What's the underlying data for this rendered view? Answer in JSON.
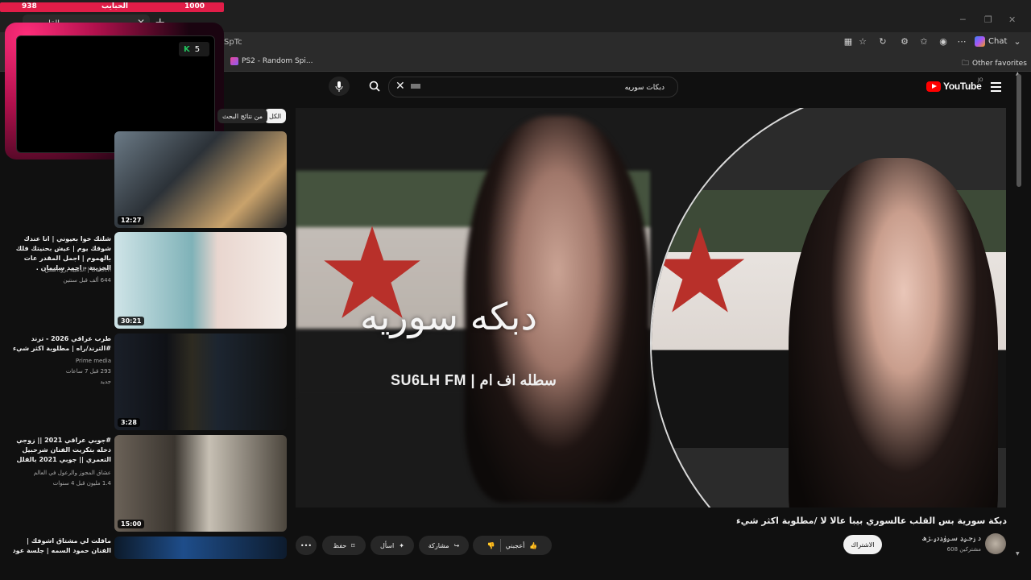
{
  "overlay": {
    "left_value": "938",
    "center_label": "الحبايب",
    "right_value": "1000",
    "score_value": "5"
  },
  "browser": {
    "tab_title": "ج ريه بس القلب",
    "url_fragment": "SpTc",
    "bookmarks": [
      {
        "label": "PS2 - Random Spi..."
      },
      {
        "label": "Other favorites"
      }
    ],
    "chat_label": "Chat"
  },
  "youtube": {
    "logo_text": "YouTube",
    "logo_sup": "JO",
    "search_value": "دبكات سوريه",
    "chips": {
      "active": "الكل",
      "normal": "من نتائج البحث"
    },
    "player": {
      "overlay_title": "دبكه سوريه",
      "overlay_subtitle": "SU6LH FM | سطله اف ام"
    },
    "video": {
      "title": "دبكة سورية بس القلب عالسوري بيبا عالا لا /مطلوبة اكثر شيء",
      "channel": "د ۏجـﯠﮃ ﺳـﯠﯛﮃﺩﯠۦﮋﮪ",
      "subs": "608 مشتركين",
      "subscribe_label": "الاشتراك",
      "actions": {
        "like": "أعجبني",
        "share": "مشاركة",
        "ask": "اسأل",
        "save": "حفظ"
      }
    },
    "recommendations": [
      {
        "duration": "12:27",
        "title": "",
        "channel": "",
        "meta": ""
      },
      {
        "duration": "30:21",
        "title": "شلتك خوا بعيوني | انا عندك شوقك يوم | عيش بحنيتك فلك بالهموم | اجمل المقدر عات الحزينة - احمد سليمان .",
        "channel": "Golden | الذهبية بروداكشن",
        "meta": "644 ألف  قبل سنتين"
      },
      {
        "duration": "3:28",
        "title": "طرب عراقي 2026 - ترند #الترند/راه | مطلوبة اكثر شيء",
        "channel": "Prime media",
        "meta": "293  قبل 7 ساعات",
        "badge": "جديد"
      },
      {
        "duration": "15:00",
        "title": "#جوبي عراقي 2021 || زوجي دخله بتكريت الفنان شرحبيل التعمري || جوبي 2021 بالقلل",
        "channel": "عشاق المجوز والرعول في العالم",
        "meta": "1.4 مليون  قبل 4 سنوات"
      },
      {
        "duration": "",
        "title": "ماقلت لي مشتاق اشوفك | الفنان حمود السمه | جلسة عود",
        "channel": "",
        "meta": ""
      }
    ]
  },
  "colors": {
    "accent": "#ff0000",
    "overlay_pink": "#e11d48"
  }
}
